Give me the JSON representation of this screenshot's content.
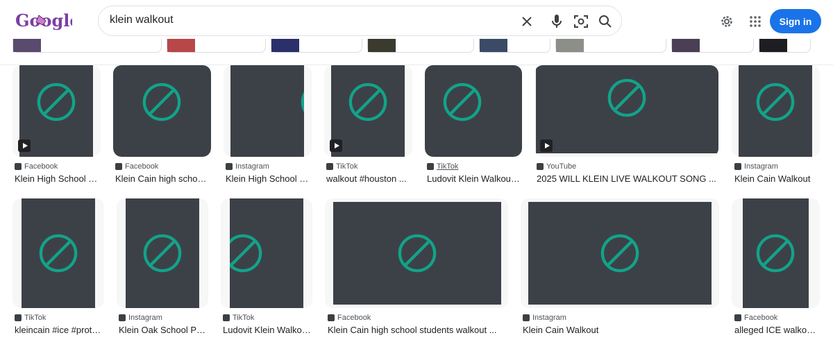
{
  "header": {
    "logo": "Google",
    "search_value": "klein walkout",
    "signin_label": "Sign in"
  },
  "colors": {
    "placeholder_bg": "#3c4148",
    "placeholder_icon": "#12a389",
    "accent": "#1a73e8"
  },
  "row1": [
    {
      "source": "Facebook",
      "title": "Klein High School st..."
    },
    {
      "source": "Facebook",
      "title": "Klein Cain high school ..."
    },
    {
      "source": "Instagram",
      "title": "Klein High School W..."
    },
    {
      "source": "TikTok",
      "title": "walkout #houston ..."
    },
    {
      "source": "TikTok",
      "title": "Ludovit Klein Walkout ..."
    },
    {
      "source": "YouTube",
      "title": "2025 WILL KLEIN LIVE WALKOUT SONG ..."
    },
    {
      "source": "Instagram",
      "title": "Klein Cain Walkout"
    }
  ],
  "row2": [
    {
      "source": "TikTok",
      "title": "kleincain #ice #prote..."
    },
    {
      "source": "Instagram",
      "title": "Klein Oak School Pro..."
    },
    {
      "source": "TikTok",
      "title": "Ludovit Klein Walkou..."
    },
    {
      "source": "Facebook",
      "title": "Klein Cain high school students walkout ..."
    },
    {
      "source": "Instagram",
      "title": "Klein Cain Walkout"
    },
    {
      "source": "Facebook",
      "title": "alleged ICE walkout ..."
    }
  ]
}
